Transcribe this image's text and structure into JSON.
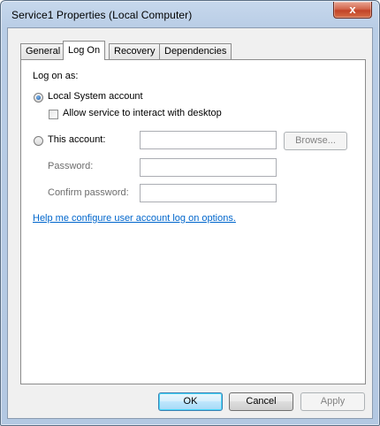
{
  "window": {
    "title": "Service1 Properties (Local Computer)",
    "close_glyph": "x"
  },
  "tabs": [
    {
      "label": "General",
      "active": false
    },
    {
      "label": "Log On",
      "active": true
    },
    {
      "label": "Recovery",
      "active": false
    },
    {
      "label": "Dependencies",
      "active": false
    }
  ],
  "logon": {
    "section_label": "Log on as:",
    "local_system": {
      "label": "Local System account",
      "checked": true
    },
    "interact_desktop": {
      "label": "Allow service to interact with desktop",
      "checked": false
    },
    "this_account": {
      "label": "This account:",
      "checked": false,
      "value": ""
    },
    "browse_label": "Browse...",
    "password": {
      "label": "Password:",
      "value": ""
    },
    "confirm_password": {
      "label": "Confirm password:",
      "value": ""
    },
    "help_link": "Help me configure user account log on options."
  },
  "buttons": {
    "ok": "OK",
    "cancel": "Cancel",
    "apply": "Apply"
  }
}
